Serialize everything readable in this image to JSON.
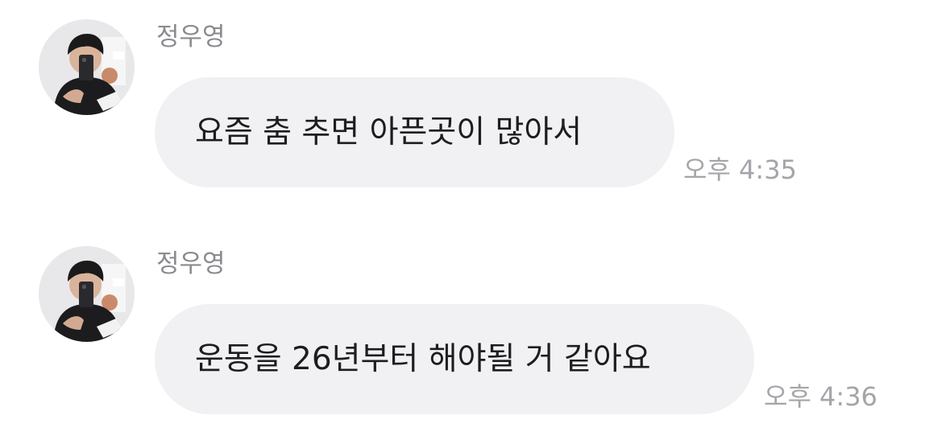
{
  "messages": [
    {
      "sender": "정우영",
      "text": "요즘 춤 추면 아픈곳이 많아서",
      "time": "오후 4:35"
    },
    {
      "sender": "정우영",
      "text": "운동을 26년부터 해야될 거 같아요",
      "time": "오후 4:36"
    }
  ],
  "colors": {
    "bubble_bg": "#f1f1f3",
    "sender_text": "#8b8b8f",
    "time_text": "#a5a5a9",
    "message_text": "#1d1d1f"
  }
}
